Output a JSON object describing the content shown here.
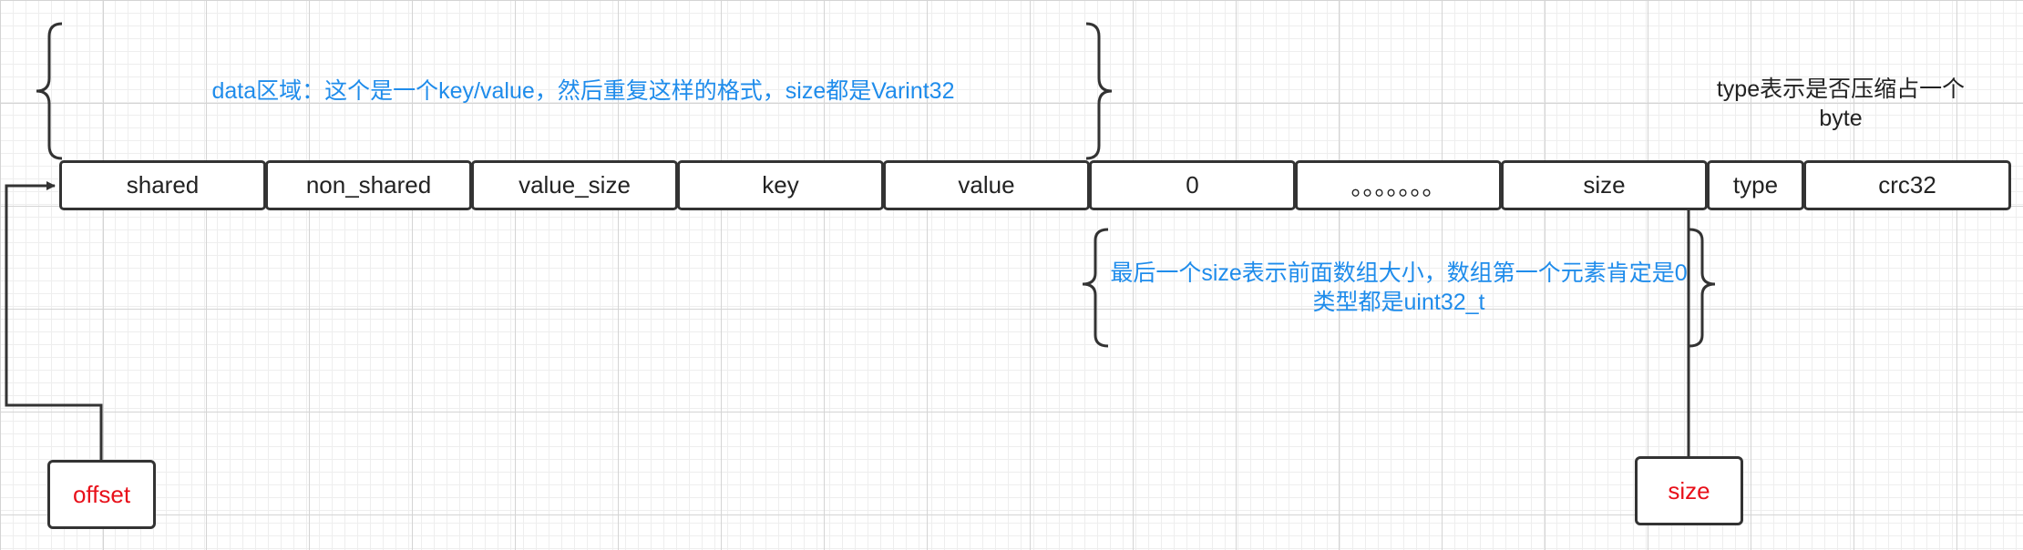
{
  "colors": {
    "note": "#1f8ceb",
    "label": "#e8101a",
    "stroke": "#333333"
  },
  "data_note": "data区域：这个是一个key/value，然后重复这样的格式，size都是Varint32",
  "type_note": [
    "type表示是否压缩占一个",
    "byte"
  ],
  "size_note": [
    "最后一个size表示前面数组大小，数组第一个元素肯定是0",
    "类型都是uint32_t"
  ],
  "cells": {
    "shared": "shared",
    "non_shared": "non_shared",
    "value_size": "value_size",
    "key": "key",
    "value": "value",
    "zero": "0",
    "ellipsis": "。。。。。。。",
    "size": "size",
    "type": "type",
    "crc32": "crc32"
  },
  "labels": {
    "offset": "offset",
    "size": "size"
  }
}
